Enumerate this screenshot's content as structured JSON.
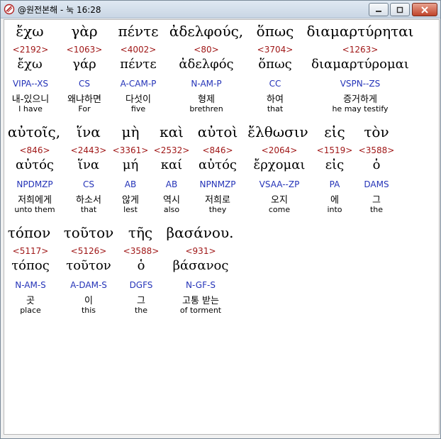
{
  "window": {
    "title": "@원전본해 - 눅 16:28"
  },
  "rows": [
    {
      "words": [
        {
          "greek": "ἔχω",
          "strong": "<2192>",
          "lemma": "ἔχω",
          "parse": "VIPA--XS",
          "korean": "내-있으니",
          "english": "I have"
        },
        {
          "greek": "γὰρ",
          "strong": "<1063>",
          "lemma": "γάρ",
          "parse": "CS",
          "korean": "왜냐하면",
          "english": "For"
        },
        {
          "greek": "πέντε",
          "strong": "<4002>",
          "lemma": "πέντε",
          "parse": "A-CAM-P",
          "korean": "다섯이",
          "english": "five"
        },
        {
          "greek": "ἀδελφούς,",
          "strong": "<80>",
          "lemma": "ἀδελφός",
          "parse": "N-AM-P",
          "korean": "형제",
          "english": "brethren"
        },
        {
          "greek": "ὅπως",
          "strong": "<3704>",
          "lemma": "ὅπως",
          "parse": "CC",
          "korean": "하여",
          "english": "that"
        },
        {
          "greek": "διαμαρτύρηται",
          "strong": "<1263>",
          "lemma": "διαμαρτύρομαι",
          "parse": "VSPN--ZS",
          "korean": "증거하게",
          "english": "he may testify"
        }
      ]
    },
    {
      "words": [
        {
          "greek": "αὐτοῖς,",
          "strong": "<846>",
          "lemma": "αὐτός",
          "parse": "NPDMZP",
          "korean": "저희에게",
          "english": "unto them"
        },
        {
          "greek": "ἵνα",
          "strong": "<2443>",
          "lemma": "ἵνα",
          "parse": "CS",
          "korean": "하소서",
          "english": "that"
        },
        {
          "greek": "μὴ",
          "strong": "<3361>",
          "lemma": "μή",
          "parse": "AB",
          "korean": "않게",
          "english": "lest"
        },
        {
          "greek": "καὶ",
          "strong": "<2532>",
          "lemma": "καί",
          "parse": "AB",
          "korean": "역시",
          "english": "also"
        },
        {
          "greek": "αὐτοὶ",
          "strong": "<846>",
          "lemma": "αὐτός",
          "parse": "NPNMZP",
          "korean": "저희로",
          "english": "they"
        },
        {
          "greek": "ἔλθωσιν",
          "strong": "<2064>",
          "lemma": "ἔρχομαι",
          "parse": "VSAA--ZP",
          "korean": "오지",
          "english": "come"
        },
        {
          "greek": "εἰς",
          "strong": "<1519>",
          "lemma": "εἰς",
          "parse": "PA",
          "korean": "에",
          "english": "into"
        },
        {
          "greek": "τὸν",
          "strong": "<3588>",
          "lemma": "ὁ",
          "parse": "DAMS",
          "korean": "그",
          "english": "the"
        }
      ]
    },
    {
      "words": [
        {
          "greek": "τόπον",
          "strong": "<5117>",
          "lemma": "τόπος",
          "parse": "N-AM-S",
          "korean": "곳",
          "english": "place"
        },
        {
          "greek": "τοῦτον",
          "strong": "<5126>",
          "lemma": "τοῦτον",
          "parse": "A-DAM-S",
          "korean": "이",
          "english": "this"
        },
        {
          "greek": "τῆς",
          "strong": "<3588>",
          "lemma": "ὁ",
          "parse": "DGFS",
          "korean": "그",
          "english": "the"
        },
        {
          "greek": "βασάνου.",
          "strong": "<931>",
          "lemma": "βάσανος",
          "parse": "N-GF-S",
          "korean": "고통 받는",
          "english": "of torment"
        }
      ]
    }
  ],
  "colors": {
    "strong": "#a01818",
    "parse": "#2433b8",
    "text": "#000000"
  },
  "icons": {
    "app": "scroll-icon",
    "minimize": "minimize-icon",
    "maximize": "maximize-icon",
    "close": "close-icon"
  }
}
